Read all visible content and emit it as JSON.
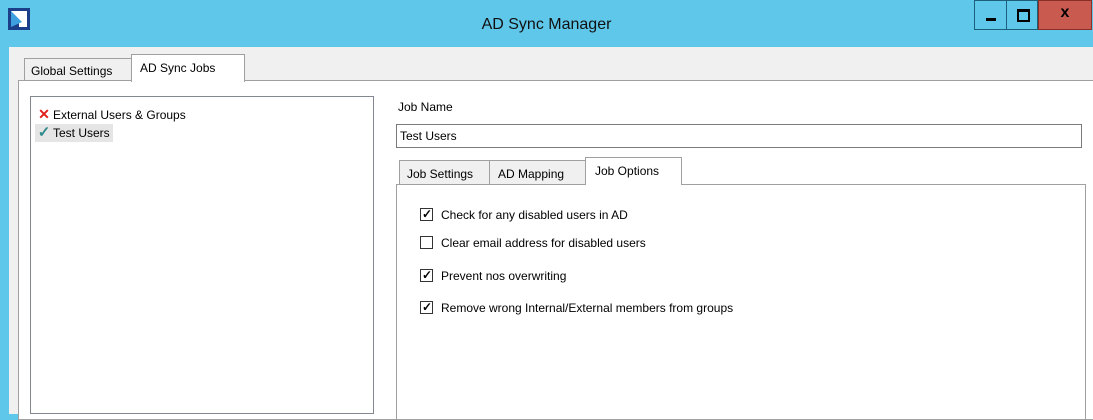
{
  "window": {
    "title": "AD Sync Manager",
    "icons": [
      "app-icon",
      "minimize-icon",
      "maximize-icon",
      "close-icon"
    ],
    "close_glyph": "x"
  },
  "tabs": [
    {
      "label": "Global Settings",
      "active": false
    },
    {
      "label": "AD Sync Jobs",
      "active": true
    }
  ],
  "jobs": [
    {
      "label": "External Users & Groups",
      "status": "error",
      "glyph": "✕"
    },
    {
      "label": "Test Users",
      "status": "ok",
      "glyph": "✓",
      "selected": true
    }
  ],
  "job_name": {
    "label": "Job Name",
    "value": "Test Users"
  },
  "sub_tabs": [
    {
      "label": "Job Settings",
      "active": false
    },
    {
      "label": "AD Mapping",
      "active": false
    },
    {
      "label": "Job Options",
      "active": true
    }
  ],
  "options": [
    {
      "label": "Check for any disabled users in AD",
      "checked": true
    },
    {
      "label": "Clear email address for disabled users",
      "checked": false
    },
    {
      "label": "Prevent nos overwriting",
      "checked": true
    },
    {
      "label": "Remove wrong Internal/External members from groups",
      "checked": true
    }
  ],
  "colors": {
    "titlebar": "#5fc8ea",
    "close_button": "#c95a4f",
    "error": "#e0201a",
    "ok": "#2e8b8b"
  }
}
